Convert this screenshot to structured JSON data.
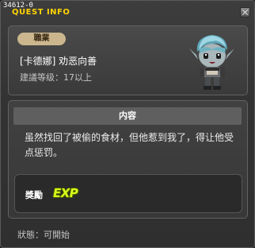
{
  "window": {
    "quest_id": "34612-0",
    "title": "QUEST INFO"
  },
  "info": {
    "job_badge": "職業",
    "quest_name": "[卡德娜] 劝恶向善",
    "recommend_level": "建議等级：17以上"
  },
  "detail": {
    "content_header": "内容",
    "content_text": "虽然找回了被偷的食材，但他惹到我了，得让他受点惩罚。",
    "reward_label": "獎勵",
    "reward_icon_text": "EXP"
  },
  "status": {
    "text": "狀態：可開始"
  },
  "colors": {
    "title": "#ffd400",
    "badge_bg": "#cbb68e",
    "exp": "#d7ff1c"
  },
  "icons": {
    "close": "close-icon",
    "npc": "npc-portrait",
    "exp": "exp-icon"
  }
}
